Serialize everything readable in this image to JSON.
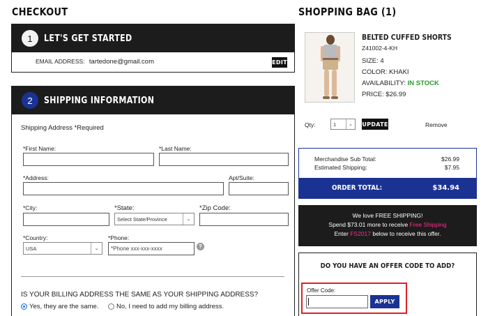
{
  "checkout": {
    "title": "CHECKOUT",
    "step1": {
      "number": "1",
      "title": "LET'S GET STARTED",
      "email_label": "EMAIL ADDRESS:",
      "email_value": "tartedone@gmail.com",
      "edit_label": "EDIT"
    },
    "step2": {
      "number": "2",
      "title": "SHIPPING INFORMATION",
      "shipping_address_label": "Shipping Address *Required",
      "fields": {
        "first_name": {
          "label": "*First Name:",
          "value": ""
        },
        "last_name": {
          "label": "*Last Name:",
          "value": ""
        },
        "address": {
          "label": "*Address:",
          "value": ""
        },
        "apt": {
          "label": "Apt/Suite:",
          "value": ""
        },
        "city": {
          "label": "*City:",
          "value": ""
        },
        "state": {
          "label": "*State:",
          "selected": "Select State/Province"
        },
        "zip": {
          "label": "*Zip Code:",
          "value": ""
        },
        "country": {
          "label": "*Country:",
          "selected": "USA"
        },
        "phone": {
          "label": "*Phone:",
          "placeholder": "*Phone xxx-xxx-xxxx"
        }
      },
      "help_icon": "?",
      "billing_question": "IS YOUR BILLING ADDRESS THE SAME AS YOUR SHIPPING ADDRESS?",
      "billing_yes": "Yes, they are the same.",
      "billing_no": "No, I need to add my billing address."
    }
  },
  "bag": {
    "title": "SHOPPING BAG (1)",
    "item": {
      "name": "BELTED CUFFED SHORTS",
      "sku": "Z41002-4-KH",
      "size": "SIZE: 4",
      "color": "COLOR: KHAKI",
      "availability_label": "AVAILABILITY:",
      "availability_value": "IN STOCK",
      "price": "PRICE: $26.99",
      "qty_label": "Qty:",
      "qty_value": "1",
      "update_label": "UPDATE",
      "remove_label": "Remove"
    },
    "summary": {
      "subtotal_label": "Merchandise Sub Total:",
      "subtotal_value": "$26.99",
      "shipping_label": "Estimated Shipping:",
      "shipping_value": "$7.95",
      "total_label": "ORDER TOTAL:",
      "total_value": "$34.94"
    },
    "promo": {
      "line1": "We love FREE SHIPPING!",
      "line2_pre": "Spend $73.01 more to receive ",
      "line2_highlight": "Free Shipping",
      "line3_pre": "Enter ",
      "line3_code": "FS2017",
      "line3_post": " below to receive this offer."
    },
    "offer": {
      "question": "DO YOU HAVE AN OFFER CODE TO ADD?",
      "code_label": "Offer Code:",
      "code_value": "",
      "apply_label": "APPLY"
    }
  },
  "colors": {
    "accent_blue": "#1a3393",
    "header_black": "#1c1c1c",
    "in_stock_green": "#2a9a2a",
    "promo_pink": "#ff2d8a",
    "highlight_red": "#e02020"
  }
}
